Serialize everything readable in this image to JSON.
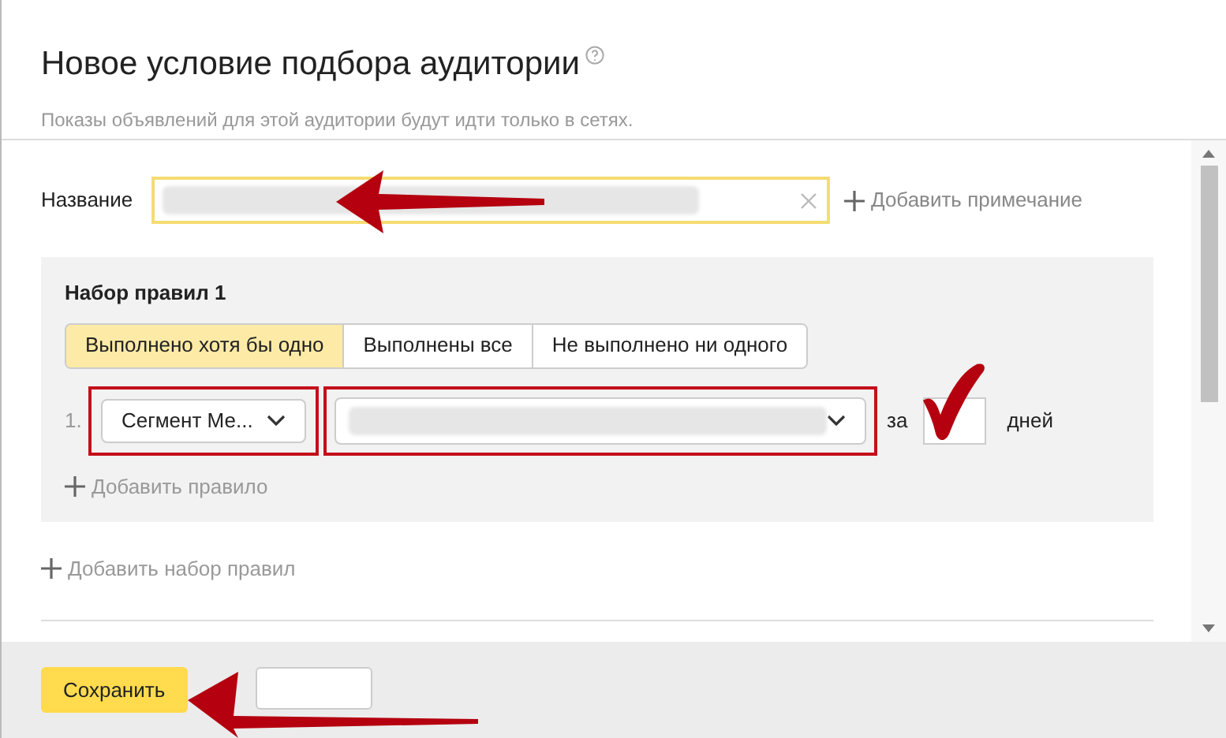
{
  "dialog": {
    "title": "Новое условие подбора аудитории",
    "subtitle": "Показы объявлений для этой аудитории будут идти только в сетях."
  },
  "name_field": {
    "label": "Название",
    "add_note": "Добавить примечание"
  },
  "rule_set": {
    "title": "Набор правил 1",
    "tabs": [
      {
        "label": "Выполнено хотя бы одно",
        "selected": true
      },
      {
        "label": "Выполнены все",
        "selected": false
      },
      {
        "label": "Не выполнено ни одного",
        "selected": false
      }
    ],
    "rules": [
      {
        "number": "1.",
        "type": "Сегмент Ме...",
        "period_prefix": "за",
        "period_suffix": "дней"
      }
    ],
    "add_rule": "Добавить правило"
  },
  "add_rule_set": "Добавить набор правил",
  "footer": {
    "save": "Сохранить"
  }
}
